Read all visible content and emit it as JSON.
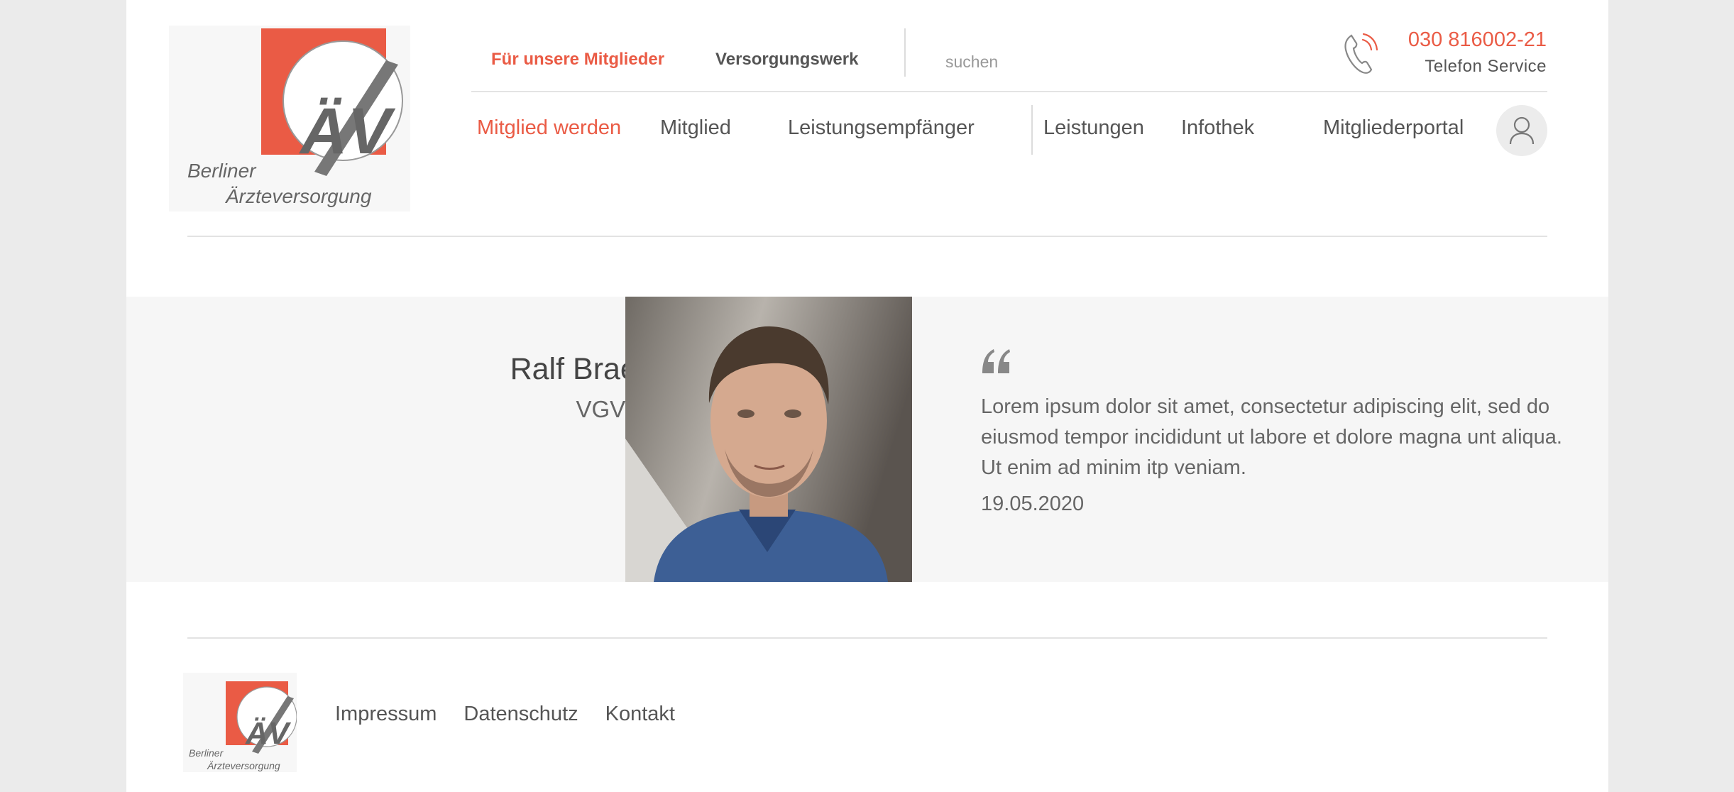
{
  "brand": {
    "logo_line1": "Berliner",
    "logo_line2": "Ärzteversorgung",
    "logo_mark": "ÄV",
    "accent_color": "#ea5b45",
    "logo_icon": "baev-logo"
  },
  "topnav": {
    "members": "Für unsere Mitglieder",
    "fund": "Versorgungswerk"
  },
  "search": {
    "placeholder": "suchen",
    "icon": "search-icon"
  },
  "contact": {
    "phone": "030 816002-21",
    "label": "Telefon Service",
    "icon": "phone-icon"
  },
  "mainnav": {
    "items": [
      {
        "label": "Mitglied werden",
        "active": true
      },
      {
        "label": "Mitglied"
      },
      {
        "label": "Leistungsempfänger"
      },
      {
        "label": "Leistungen"
      },
      {
        "label": "Infothek"
      },
      {
        "label": "Mitgliederportal"
      }
    ],
    "account_icon": "user-icon"
  },
  "testimonial": {
    "name": "Ralf Braeuer",
    "company": "VGV mbH",
    "quote": "Lorem ipsum dolor sit amet, consectetur adipiscing elit, sed do eiusmod tempor incididunt ut labore et dolore magna unt aliqua. Ut enim ad minim itp veniam.",
    "date": "19.05.2020",
    "quote_icon": "quote-icon"
  },
  "footer": {
    "links": [
      "Impressum",
      "Datenschutz",
      "Kontakt"
    ]
  }
}
